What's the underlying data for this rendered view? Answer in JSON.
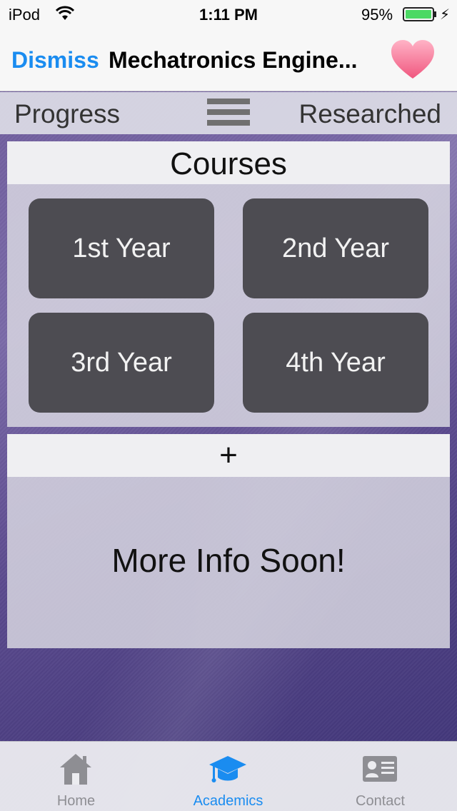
{
  "status_bar": {
    "carrier": "iPod",
    "time": "1:11 PM",
    "battery_percent": "95%",
    "battery_level": 0.95,
    "charging_icon": "bolt-icon"
  },
  "nav_bar": {
    "dismiss_label": "Dismiss",
    "title": "Mechatronics Engine...",
    "favorite_icon": "heart-icon",
    "favorite_color": "#f36d8f"
  },
  "segment_bar": {
    "left_label": "Progress",
    "menu_icon": "hamburger-menu-icon",
    "right_label": "Researched"
  },
  "courses": {
    "header": "Courses",
    "years": [
      "1st Year",
      "2nd Year",
      "3rd Year",
      "4th Year"
    ]
  },
  "info": {
    "expand_label": "+",
    "message": "More Info Soon!"
  },
  "tab_bar": {
    "tabs": [
      {
        "label": "Home",
        "icon": "home-icon",
        "active": false
      },
      {
        "label": "Academics",
        "icon": "graduation-cap-icon",
        "active": true
      },
      {
        "label": "Contact",
        "icon": "contact-card-icon",
        "active": false
      }
    ],
    "accent_color": "#1a8cf0"
  }
}
